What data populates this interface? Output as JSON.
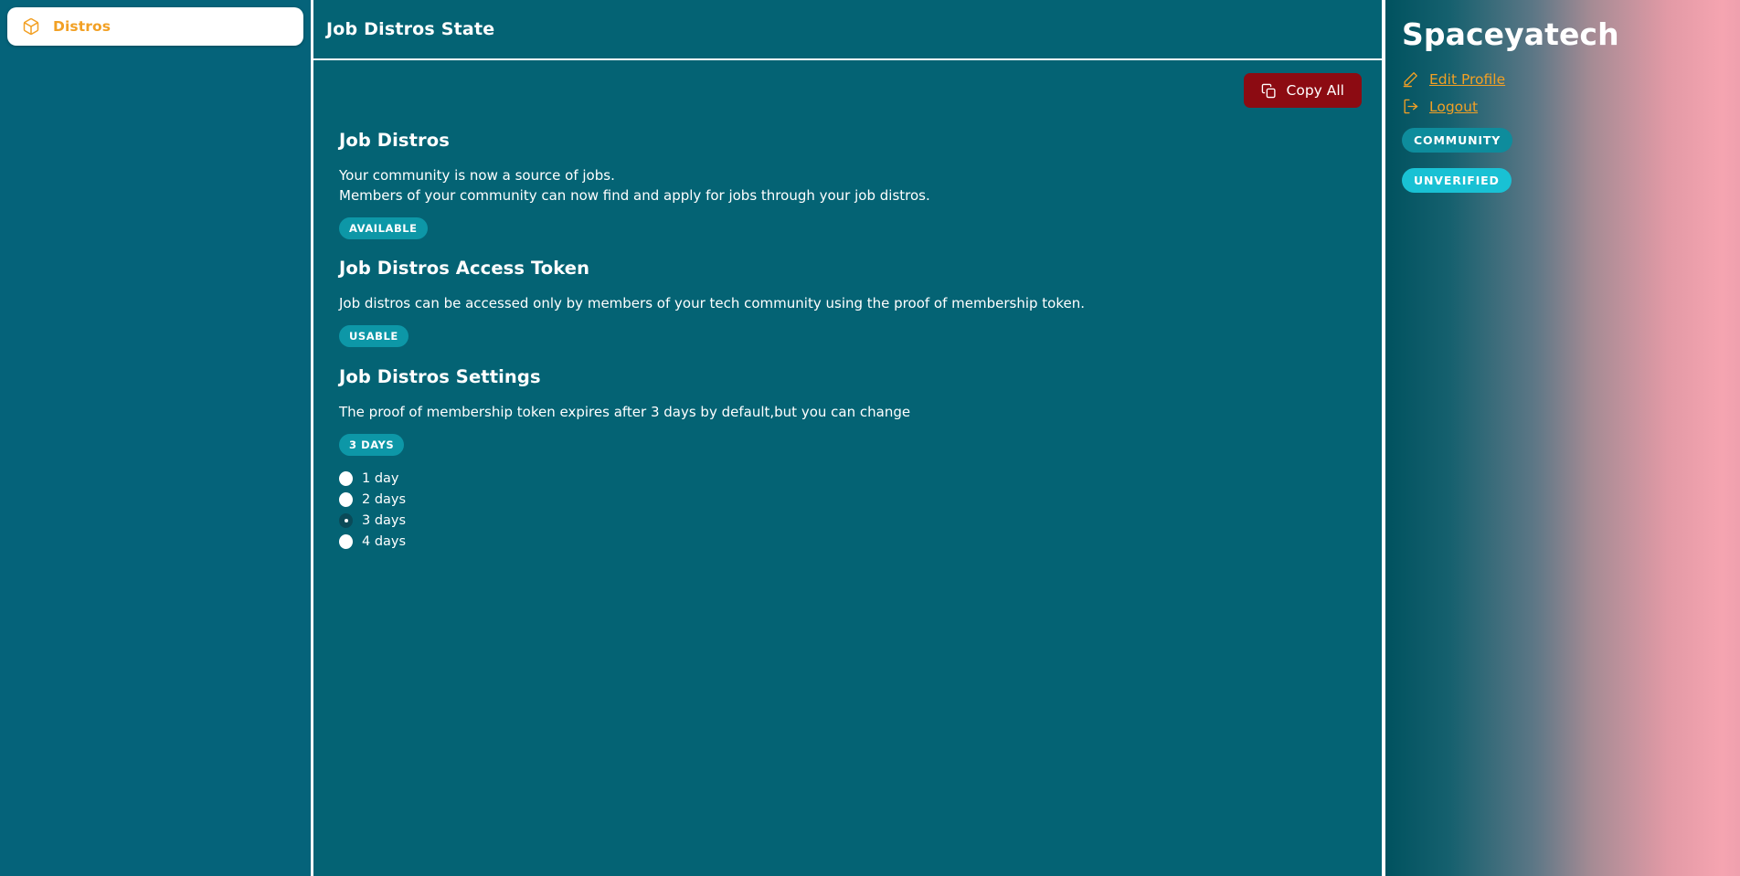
{
  "sidebar": {
    "nav": [
      {
        "label": "Distros",
        "icon": "box-icon"
      }
    ]
  },
  "main": {
    "header": {
      "title": "Job Distros State"
    },
    "toolbar": {
      "copy_all_label": "Copy All",
      "copy_icon": "copy-icon"
    },
    "sections": [
      {
        "title": "Job Distros",
        "lines": [
          "Your community is now a source of jobs.",
          "Members of your community can now find and apply for jobs through your job distros."
        ],
        "badge": "AVAILABLE"
      },
      {
        "title": "Job Distros Access Token",
        "lines": [
          "Job distros can be accessed only by members of your tech community using the proof of membership token."
        ],
        "badge": "USABLE"
      },
      {
        "title": "Job Distros Settings",
        "lines": [
          "The proof of membership token expires after 3 days by default,but you can change"
        ],
        "badge": "3 DAYS",
        "radio_options": [
          {
            "label": "1 day",
            "selected": false
          },
          {
            "label": "2 days",
            "selected": false
          },
          {
            "label": "3 days",
            "selected": true
          },
          {
            "label": "4 days",
            "selected": false
          }
        ]
      }
    ]
  },
  "right_panel": {
    "org_name": "Spaceyatech",
    "links": [
      {
        "label": "Edit Profile",
        "icon": "pencil-icon"
      },
      {
        "label": "Logout",
        "icon": "logout-icon"
      }
    ],
    "tags": [
      "COMMUNITY",
      "UNVERIFIED"
    ]
  },
  "colors": {
    "page_teal": "#05637a",
    "main_teal": "#046374",
    "accent_orange": "#f2a024",
    "danger_red": "#8c0b12",
    "badge_teal": "#0d97a7",
    "tag_community": "#0e8c9c",
    "tag_unverified": "#19c1d4",
    "gradient_start": "#00525f",
    "gradient_end": "#efa0ae"
  }
}
